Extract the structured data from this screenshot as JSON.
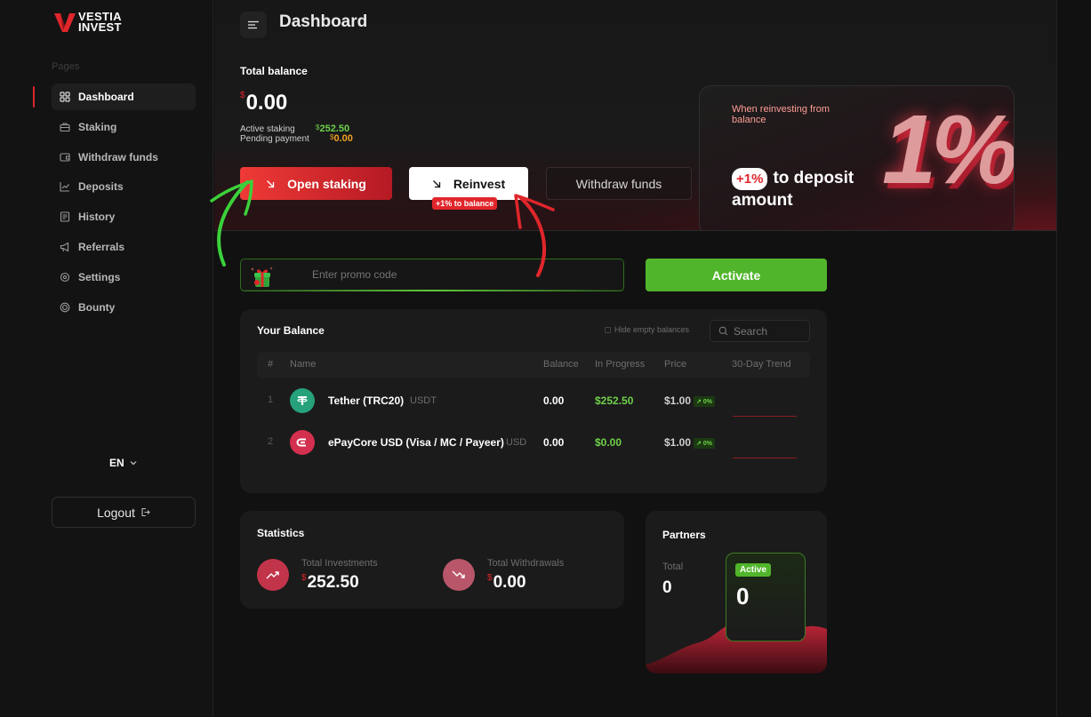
{
  "brand": {
    "line1": "VESTIA",
    "line2": "INVEST",
    "accent": "#e0262b"
  },
  "sidebar": {
    "section_label": "Pages",
    "items": [
      {
        "label": "Dashboard",
        "icon": "grid-icon",
        "active": true
      },
      {
        "label": "Staking",
        "icon": "briefcase-icon",
        "active": false
      },
      {
        "label": "Withdraw funds",
        "icon": "wallet-icon",
        "active": false
      },
      {
        "label": "Deposits",
        "icon": "chart-line-icon",
        "active": false
      },
      {
        "label": "History",
        "icon": "document-icon",
        "active": false
      },
      {
        "label": "Referrals",
        "icon": "megaphone-icon",
        "active": false
      },
      {
        "label": "Settings",
        "icon": "gear-icon",
        "active": false
      },
      {
        "label": "Bounty",
        "icon": "target-icon",
        "active": false
      }
    ],
    "language": "EN",
    "logout_label": "Logout"
  },
  "header": {
    "title": "Dashboard"
  },
  "hero": {
    "total_balance_label": "Total balance",
    "currency_symbol": "$",
    "total_balance": "0.00",
    "active_staking_label": "Active staking",
    "active_staking_value": "252.50",
    "pending_payment_label": "Pending payment",
    "pending_payment_value": "0.00",
    "open_staking_label": "Open staking",
    "reinvest_label": "Reinvest",
    "reinvest_badge": "+1% to balance",
    "withdraw_label": "Withdraw funds"
  },
  "promo_banner": {
    "small_text": "When reinvesting from balance",
    "pill": "+1%",
    "big_text": "to deposit amount",
    "big_graphic": "1%"
  },
  "promo": {
    "placeholder": "Enter promo code",
    "activate_label": "Activate"
  },
  "balance": {
    "title": "Your Balance",
    "hide_empty_label": "Hide empty balances",
    "search_placeholder": "Search",
    "columns": [
      "#",
      "Name",
      "Balance",
      "In Progress",
      "Price",
      "30-Day Trend"
    ],
    "rows": [
      {
        "index": "1",
        "name": "Tether (TRC20)",
        "ticker": "USDT",
        "balance": "0.00",
        "in_progress": "$252.50",
        "price": "$1.00",
        "change": "0%",
        "icon": "tether-icon",
        "color": "#26a17b"
      },
      {
        "index": "2",
        "name": "ePayCore USD (Visa / MC / Payeer)",
        "ticker": "USD",
        "balance": "0.00",
        "in_progress": "$0.00",
        "price": "$1.00",
        "change": "0%",
        "icon": "epaycore-icon",
        "color": "#d32f4e"
      }
    ]
  },
  "statistics": {
    "title": "Statistics",
    "total_investments_label": "Total Investments",
    "total_investments_value": "252.50",
    "total_withdrawals_label": "Total Withdrawals",
    "total_withdrawals_value": "0.00"
  },
  "partners": {
    "title": "Partners",
    "total_label": "Total",
    "total_value": "0",
    "active_label": "Active",
    "active_value": "0"
  }
}
